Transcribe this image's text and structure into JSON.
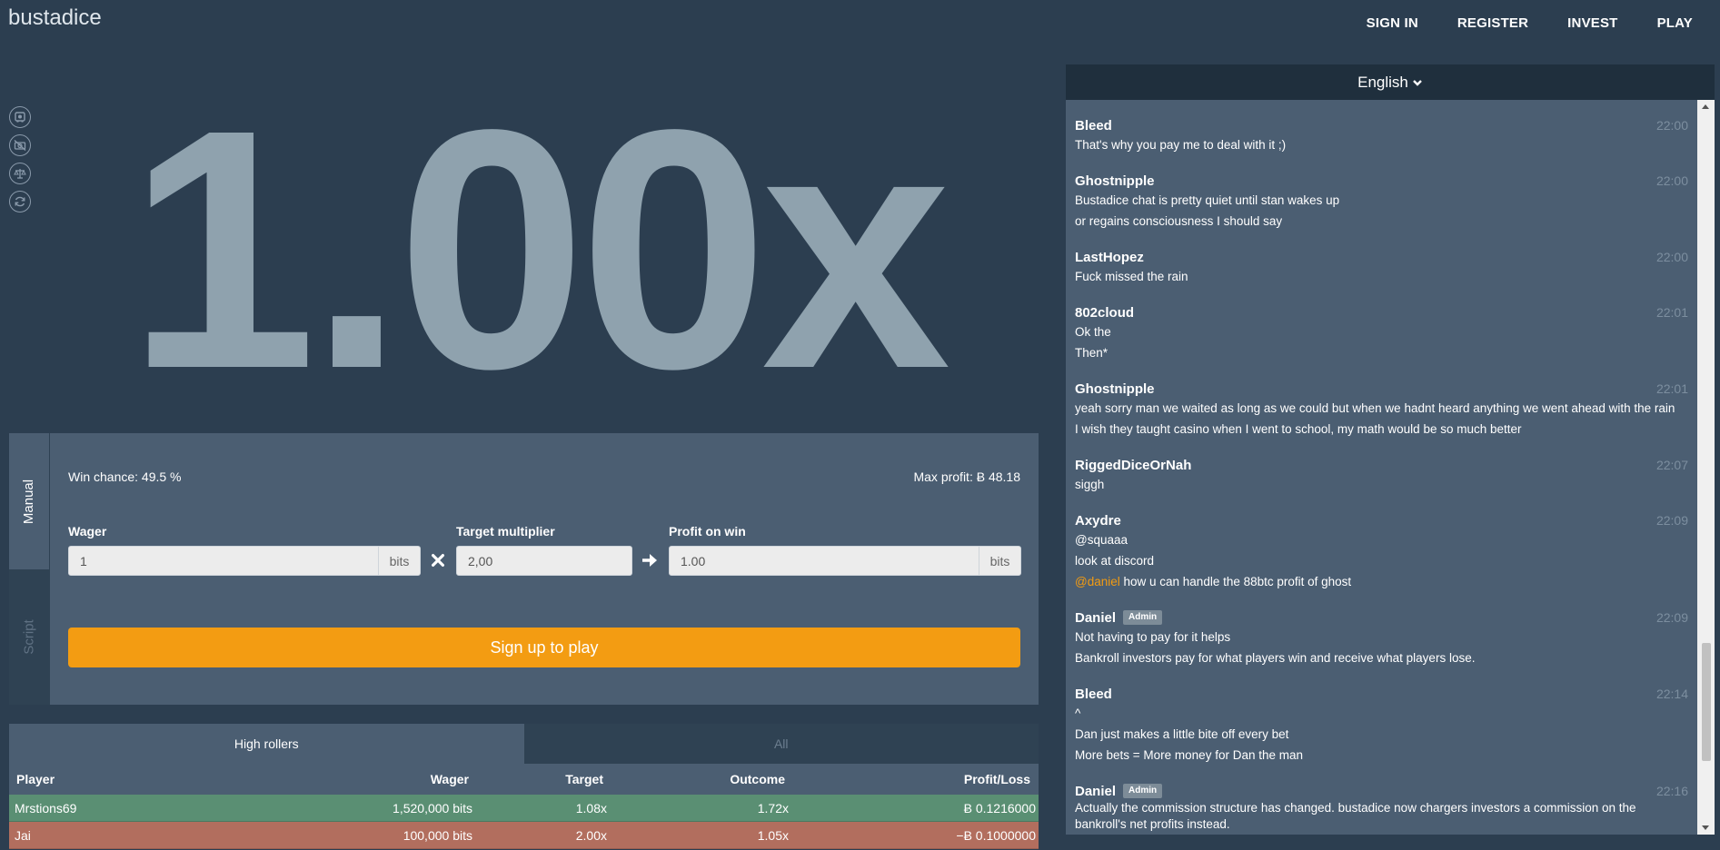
{
  "header": {
    "logo": "bustadice",
    "nav": [
      "SIGN IN",
      "REGISTER",
      "INVEST",
      "PLAY"
    ]
  },
  "side_icons": [
    "vault-icon",
    "no-camera-icon",
    "scale-icon",
    "refresh-icon"
  ],
  "game": {
    "multiplier": "1.00x"
  },
  "panel": {
    "tabs": [
      "Manual",
      "Script"
    ],
    "win_chance": "Win chance: 49.5 %",
    "max_profit": "Max profit: Ƀ 48.18",
    "wager_label": "Wager",
    "wager_value": "1",
    "wager_unit": "bits",
    "target_label": "Target multiplier",
    "target_value": "2,00",
    "profit_label": "Profit on win",
    "profit_value": "1.00",
    "profit_unit": "bits",
    "play_button": "Sign up to play"
  },
  "bets": {
    "tabs": [
      "High rollers",
      "All"
    ],
    "columns": [
      "Player",
      "Wager",
      "Target",
      "Outcome",
      "Profit/Loss"
    ],
    "rows": [
      {
        "player": "Mrstions69",
        "wager": "1,520,000 bits",
        "target": "1.08x",
        "outcome": "1.72x",
        "profit": "Ƀ 0.1216000",
        "status": "win"
      },
      {
        "player": "Jai",
        "wager": "100,000 bits",
        "target": "2.00x",
        "outcome": "1.05x",
        "profit": "−Ƀ 0.1000000",
        "status": "lose"
      }
    ]
  },
  "chat": {
    "language": "English",
    "messages": [
      {
        "user": "Bleed",
        "time": "22:00",
        "lines": [
          "That's why you pay me to deal with it ;)"
        ]
      },
      {
        "user": "Ghostnipple",
        "time": "22:00",
        "lines": [
          "Bustadice chat is pretty quiet until stan wakes up",
          "or regains consciousness I should say"
        ]
      },
      {
        "user": "LastHopez",
        "time": "22:00",
        "lines": [
          "Fuck missed the rain"
        ]
      },
      {
        "user": "802cloud",
        "time": "22:01",
        "lines": [
          "Ok the",
          "Then*"
        ]
      },
      {
        "user": "Ghostnipple",
        "time": "22:01",
        "lines": [
          "yeah sorry man we waited as long as we could but when we hadnt heard anything we went ahead with the rain",
          "I wish they taught casino when I went to school, my math would be so much better"
        ]
      },
      {
        "user": "RiggedDiceOrNah",
        "time": "22:07",
        "lines": [
          "siggh"
        ]
      },
      {
        "user": "Axydre",
        "time": "22:09",
        "lines": [
          "@squaaa",
          "look at discord",
          "@daniel how u can handle the 88btc profit of ghost"
        ]
      },
      {
        "user": "Daniel",
        "badge": "Admin",
        "time": "22:09",
        "lines": [
          "Not having to pay for it helps",
          "Bankroll investors pay for what players win and receive what players lose."
        ]
      },
      {
        "user": "Bleed",
        "time": "22:14",
        "lines": [
          "^",
          "Dan just makes a little bite off every bet",
          "More bets = More money for Dan the man"
        ]
      },
      {
        "user": "Daniel",
        "badge": "Admin",
        "time": "22:16",
        "lines": [
          "Actually the commission structure has changed. bustadice now chargers investors a commission on the",
          "bankroll's net profits instead."
        ]
      }
    ],
    "mentions": {
      "squaaa": "@squaaa",
      "daniel": "@daniel"
    }
  },
  "colors": {
    "background": "#2c3e50",
    "panel": "#4b5e72",
    "accent": "#f39c12",
    "win_row": "#5a8f73",
    "lose_row": "#b26e5e",
    "multiplier_text": "#8fa2ae"
  }
}
